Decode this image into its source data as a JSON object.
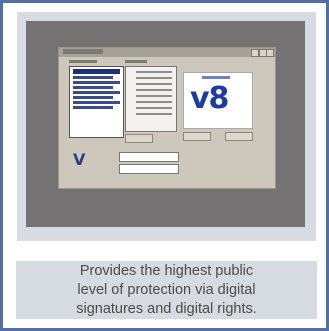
{
  "screenshot": {
    "window_title": "",
    "logo_text": "v8",
    "bottom_mark": "V"
  },
  "caption": {
    "lines": [
      "Provides the highest public",
      "level of protection via digital",
      "signatures and digital rights."
    ]
  },
  "colors": {
    "frame_border": "#4f6fa6",
    "caption_background": "#d6dbe2",
    "desktop_background": "#747272",
    "logo_blue": "#1d3aa6"
  }
}
